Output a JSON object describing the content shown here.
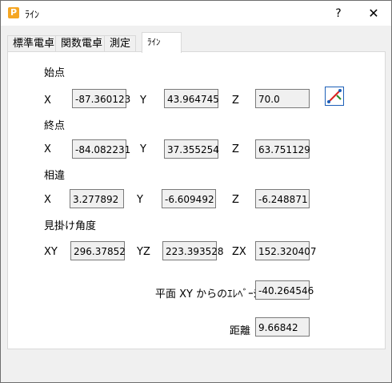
{
  "window": {
    "title": "ﾗｲﾝ",
    "help": "?",
    "close": "✕"
  },
  "tabs": [
    "標準電卓",
    "関数電卓",
    "測定",
    "ﾗｲﾝ"
  ],
  "start": {
    "heading": "始点",
    "x_label": "X",
    "x": "-87.360123",
    "y_label": "Y",
    "y": "43.964745",
    "z_label": "Z",
    "z": "70.0"
  },
  "end": {
    "heading": "終点",
    "x_label": "X",
    "x": "-84.082231",
    "y_label": "Y",
    "y": "37.355254",
    "z_label": "Z",
    "z": "63.751129"
  },
  "diff": {
    "heading": "相違",
    "x_label": "X",
    "x": "3.277892",
    "y_label": "Y",
    "y": "-6.609492",
    "z_label": "Z",
    "z": "-6.248871"
  },
  "apparent": {
    "heading": "見掛け角度",
    "xy_label": "XY",
    "xy": "296.37852",
    "yz_label": "YZ",
    "yz": "223.393528",
    "zx_label": "ZX",
    "zx": "152.320407"
  },
  "elevation": {
    "label": "平面 XY からのｴﾚﾍﾞｰｼｮﾝ",
    "value": "-40.264546"
  },
  "distance": {
    "label": "距離",
    "value": "9.66842"
  }
}
